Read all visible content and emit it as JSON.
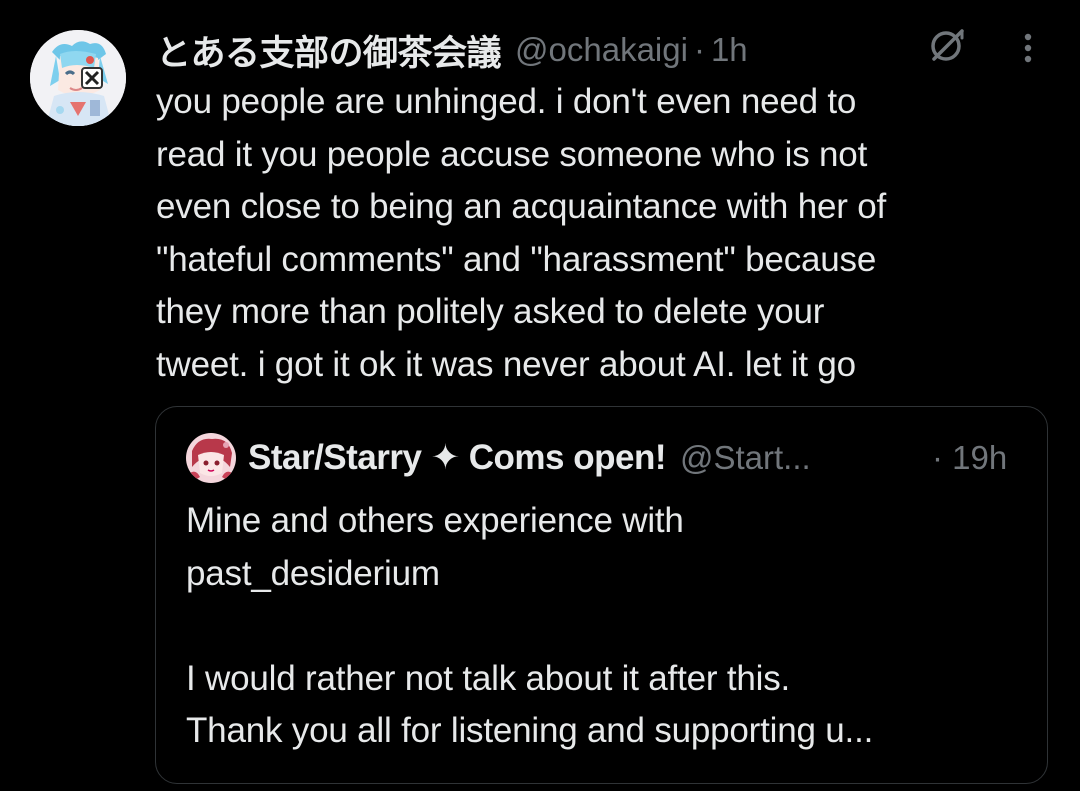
{
  "tweet": {
    "display_name": "とある支部の御茶会議",
    "handle": "@ochakaigi",
    "separator": "·",
    "timestamp": "1h",
    "avatar_icon": "anime-avatar-icon",
    "text_lines": [
      "you people are unhinged. i don't even need to",
      "read it you people accuse someone who is not",
      "even close to being an acquaintance with her of",
      "\"hateful comments\" and \"harassment\" because",
      "they more than politely asked to delete your",
      "tweet. i got it ok it was never about AI. let it go"
    ]
  },
  "actions": {
    "grok_icon": "grok-icon",
    "more_icon": "more-vertical-icon"
  },
  "quote": {
    "display_name": "Star/Starry ✦ Coms open!",
    "handle": "@Start...",
    "time": "· 19h",
    "avatar_icon": "anime-avatar-icon",
    "text_lines": [
      "Mine and others experience with",
      "past_desiderium",
      "",
      "I would rather not talk about it after this.",
      "Thank you all for listening and supporting u..."
    ]
  },
  "colors": {
    "background": "#000000",
    "primary_text": "#e7e9ea",
    "secondary_text": "#71767b",
    "border": "#2f3336"
  }
}
